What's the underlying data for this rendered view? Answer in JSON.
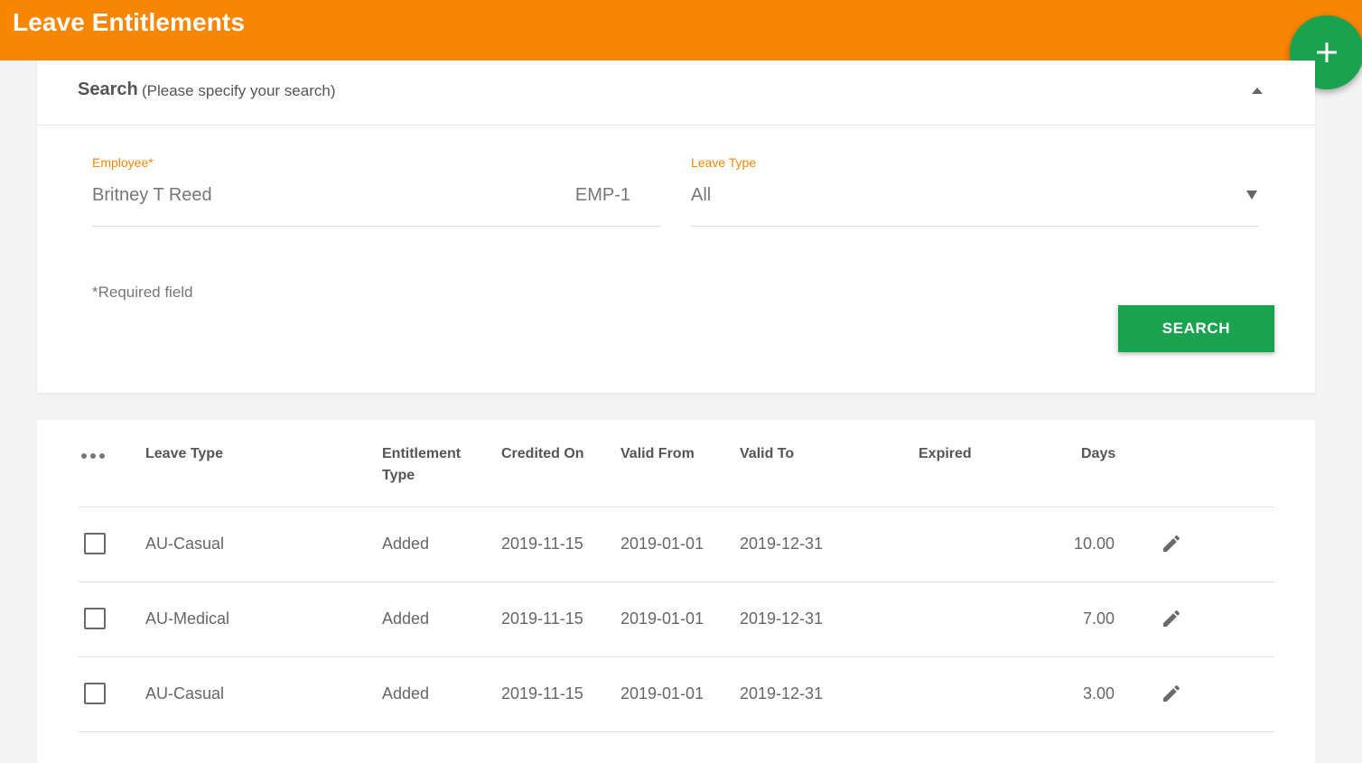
{
  "header": {
    "title": "Leave Entitlements",
    "add_icon": "plus-icon"
  },
  "search": {
    "title": "Search",
    "hint": "(Please specify your search)",
    "employee_label": "Employee",
    "employee_required_mark": "*",
    "employee_value": "Britney T Reed",
    "employee_id": "EMP-1",
    "leave_type_label": "Leave Type",
    "leave_type_value": "All",
    "required_note": "*Required field",
    "search_button": "SEARCH"
  },
  "table": {
    "columns": [
      "Leave Type",
      "Entitlement Type",
      "Credited On",
      "Valid From",
      "Valid To",
      "Expired",
      "Days"
    ],
    "rows": [
      {
        "leave_type": "AU-Casual",
        "entitlement_type": "Added",
        "credited_on": "2019-11-15",
        "valid_from": "2019-01-01",
        "valid_to": "2019-12-31",
        "expired": "",
        "days": "10.00"
      },
      {
        "leave_type": "AU-Medical",
        "entitlement_type": "Added",
        "credited_on": "2019-11-15",
        "valid_from": "2019-01-01",
        "valid_to": "2019-12-31",
        "expired": "",
        "days": "7.00"
      },
      {
        "leave_type": "AU-Casual",
        "entitlement_type": "Added",
        "credited_on": "2019-11-15",
        "valid_from": "2019-01-01",
        "valid_to": "2019-12-31",
        "expired": "",
        "days": "3.00"
      }
    ]
  },
  "colors": {
    "header": "#f88605",
    "accent_green": "#1aa34e"
  }
}
